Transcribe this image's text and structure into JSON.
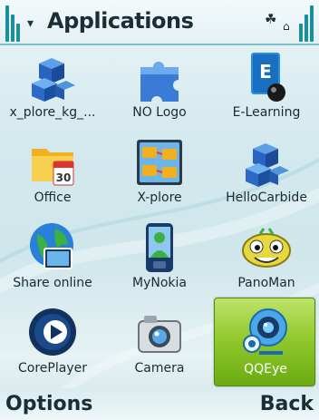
{
  "statusbar": {
    "title": "Applications",
    "signal_icon": "signal-bars-icon",
    "antenna_glyph": "▾",
    "status_glyph_1": "☘",
    "status_glyph_2": "⌂"
  },
  "apps": [
    {
      "label": "x_plore_kg_...",
      "icon": "cubes-icon"
    },
    {
      "label": "NO Logo",
      "icon": "puzzle-icon"
    },
    {
      "label": "E-Learning",
      "icon": "e-learning-book-icon"
    },
    {
      "label": "Office",
      "icon": "folder-calendar-icon",
      "badge": "30"
    },
    {
      "label": "X-plore",
      "icon": "xplore-folders-icon"
    },
    {
      "label": "HelloCarbide",
      "icon": "cubes-icon"
    },
    {
      "label": "Share online",
      "icon": "globe-share-icon"
    },
    {
      "label": "MyNokia",
      "icon": "phone-person-icon"
    },
    {
      "label": "PanoMan",
      "icon": "panoman-face-icon"
    },
    {
      "label": "CorePlayer",
      "icon": "play-button-icon"
    },
    {
      "label": "Camera",
      "icon": "camera-icon"
    },
    {
      "label": "QQEye",
      "icon": "webcam-eye-icon",
      "selected": true
    }
  ],
  "softkeys": {
    "left": "Options",
    "right": "Back"
  },
  "colors": {
    "accent": "#1b8f9b",
    "selection": "#8fc62a",
    "text": "#1a2e36"
  }
}
